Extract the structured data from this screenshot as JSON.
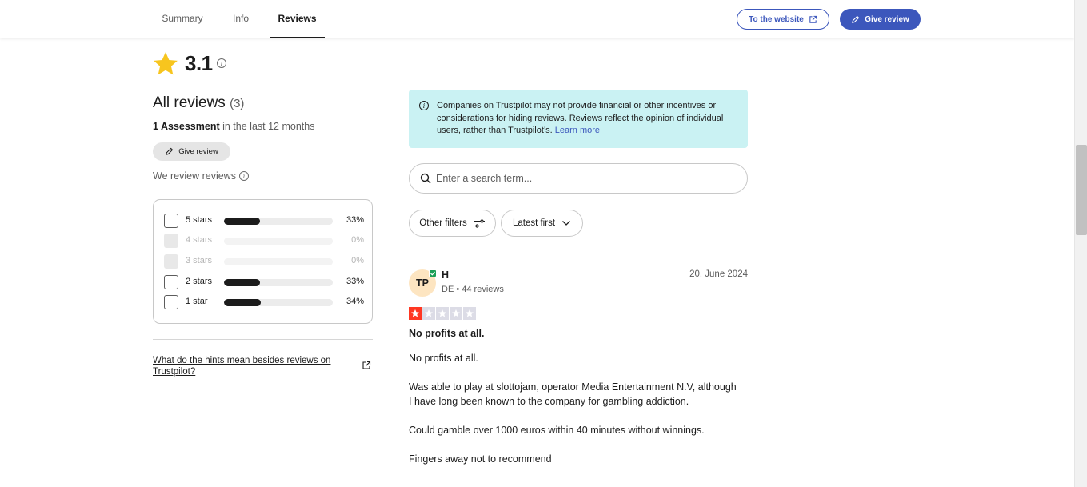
{
  "nav": {
    "tabs": [
      {
        "label": "Summary",
        "active": false
      },
      {
        "label": "Info",
        "active": false
      },
      {
        "label": "Reviews",
        "active": true
      }
    ],
    "website_button": "To the website",
    "give_review_button": "Give review"
  },
  "summary": {
    "rating": "3.1",
    "all_reviews_label": "All reviews",
    "review_count": "(3)",
    "assessment_count": "1 Assessment",
    "assessment_period": "in the last 12 months",
    "give_review_pill": "Give review",
    "we_review_reviews": "We review reviews",
    "distribution": [
      {
        "label": "5 stars",
        "percent": "33%",
        "fraction": 0.33,
        "enabled": true
      },
      {
        "label": "4 stars",
        "percent": "0%",
        "fraction": 0,
        "enabled": false
      },
      {
        "label": "3 stars",
        "percent": "0%",
        "fraction": 0,
        "enabled": false
      },
      {
        "label": "2 stars",
        "percent": "33%",
        "fraction": 0.33,
        "enabled": true
      },
      {
        "label": "1 star",
        "percent": "34%",
        "fraction": 0.34,
        "enabled": true
      }
    ],
    "hints_link": "What do the hints mean besides reviews on Trustpilot?"
  },
  "notice": {
    "text": "Companies on Trustpilot may not provide financial or other incentives or considerations for hiding reviews. Reviews reflect the opinion of individual users, rather than Trustpilot’s.",
    "learn_more": "Learn more"
  },
  "search": {
    "placeholder": "Enter a search term..."
  },
  "filters": {
    "other_filters": "Other filters",
    "sort": "Latest first"
  },
  "review": {
    "avatar_initials": "TP",
    "reviewer_name": "H",
    "reviewer_meta": "DE • 44 reviews",
    "date": "20. June 2024",
    "star_rating": 1,
    "title": "No profits at all.",
    "paragraphs": [
      "No profits at all.",
      "Was able to play at slottojam, operator Media Entertainment N.V, although I have long been known to the company for gambling addiction.",
      "Could gamble over 1000 euros within 40 minutes without winnings.",
      "Fingers away not to recommend"
    ]
  },
  "colors": {
    "brand_blue": "#3c57bc",
    "star_gold": "#f7c51e",
    "star_red": "#ff3722",
    "notice_bg": "#caf2f3",
    "verified_green": "#1b9e57"
  },
  "icons": {
    "rating_star": "star-icon",
    "external": "external-link-icon",
    "pencil": "pencil-icon",
    "info": "info-icon",
    "search": "search-icon",
    "filters": "sliders-icon",
    "sort": "chevron-down-icon"
  }
}
